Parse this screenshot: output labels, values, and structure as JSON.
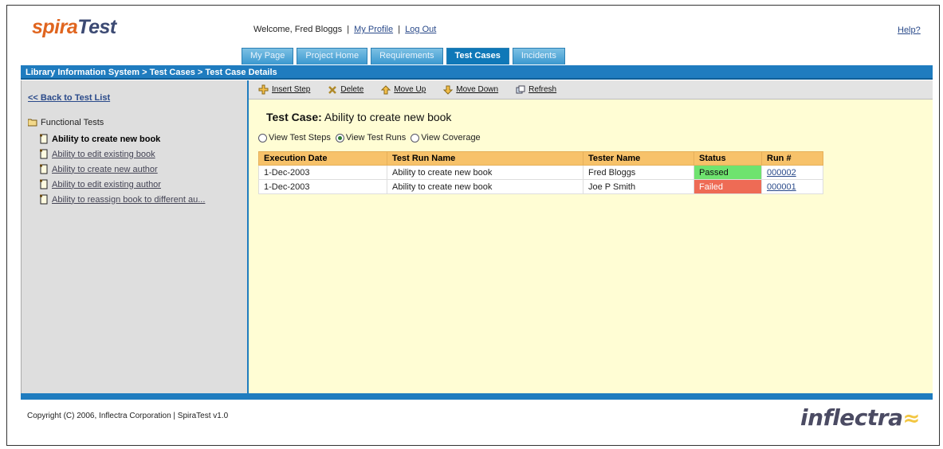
{
  "header": {
    "logo_part1": "spira",
    "logo_part2": "Test",
    "welcome_text": "Welcome, Fred Bloggs",
    "my_profile": "My Profile",
    "log_out": "Log Out",
    "help": "Help?"
  },
  "tabs": [
    {
      "label": "My Page",
      "active": false
    },
    {
      "label": "Project Home",
      "active": false
    },
    {
      "label": "Requirements",
      "active": false
    },
    {
      "label": "Test Cases",
      "active": true
    },
    {
      "label": "Incidents",
      "active": false
    }
  ],
  "breadcrumb": "Library Information System > Test Cases > Test Case Details",
  "sidebar": {
    "back_link": "<< Back to Test List",
    "folder": "Functional Tests",
    "items": [
      {
        "label": "Ability to create new book",
        "selected": true
      },
      {
        "label": "Ability to edit existing book",
        "selected": false
      },
      {
        "label": "Ability to create new author",
        "selected": false
      },
      {
        "label": "Ability to edit existing author",
        "selected": false
      },
      {
        "label": "Ability to reassign book to different au...",
        "selected": false
      }
    ]
  },
  "toolbar": {
    "insert_step": "Insert Step",
    "delete": "Delete",
    "move_up": "Move Up",
    "move_down": "Move Down",
    "refresh": "Refresh"
  },
  "test_case": {
    "label": "Test Case:",
    "name": "Ability to create new book"
  },
  "view_options": [
    {
      "label": "View Test Steps",
      "selected": false
    },
    {
      "label": "View Test Runs",
      "selected": true
    },
    {
      "label": "View Coverage",
      "selected": false
    }
  ],
  "runs_table": {
    "headers": [
      "Execution Date",
      "Test Run Name",
      "Tester Name",
      "Status",
      "Run #"
    ],
    "rows": [
      {
        "date": "1-Dec-2003",
        "name": "Ability to create new book",
        "tester": "Fred Bloggs",
        "status": "Passed",
        "run": "000002"
      },
      {
        "date": "1-Dec-2003",
        "name": "Ability to create new book",
        "tester": "Joe P Smith",
        "status": "Failed",
        "run": "000001"
      }
    ]
  },
  "footer": {
    "copyright": "Copyright (C) 2006, Inflectra Corporation | SpiraTest v1.0",
    "brand": "inflectra"
  },
  "colors": {
    "accent_blue": "#1f7cbf",
    "main_bg": "#fffdd4",
    "header_orange": "#f7c26a",
    "passed": "#6fe36f",
    "failed": "#ee6b55",
    "logo_orange": "#e0651f"
  }
}
